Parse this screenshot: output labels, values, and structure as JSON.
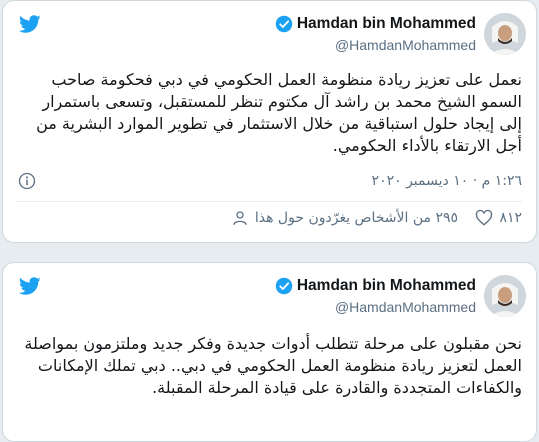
{
  "tweets": [
    {
      "author": {
        "name": "Hamdan bin Mohammed",
        "handle": "@HamdanMohammed"
      },
      "text": "نعمل على تعزيز ريادة منظومة العمل الحكومي في دبي فحكومة صاحب السمو الشيخ محمد بن راشد آل مكتوم تنظر للمستقبل، وتسعى باستمرار إلى إيجاد حلول استباقية من خلال الاستثمار في تطوير الموارد البشرية من أجل الارتقاء بالأداء الحكومي.",
      "timestamp": "١:٢٦ م · ١٠ ديسمبر ٢٠٢٠",
      "likes": "٨١٢",
      "talking": "٢٩٥ من الأشخاص يغرّدون حول هذا"
    },
    {
      "author": {
        "name": "Hamdan bin Mohammed",
        "handle": "@HamdanMohammed"
      },
      "text": "نحن مقبلون على مرحلة تتطلب أدوات جديدة وفكر جديد وملتزمون بمواصلة العمل لتعزيز ريادة منظومة العمل الحكومي في دبي.. دبي تملك الإمكانات والكفاءات المتجددة والقادرة على قيادة المرحلة المقبلة."
    }
  ],
  "colors": {
    "twitter_blue": "#1da1f2",
    "verified_blue": "#1da1f2",
    "secondary_text": "#5b7083",
    "background": "#e6ecf0"
  },
  "icons": {
    "brand": "twitter-bird-icon",
    "verified": "verified-badge-icon",
    "info": "info-icon",
    "like": "heart-icon",
    "talking": "person-icon"
  }
}
